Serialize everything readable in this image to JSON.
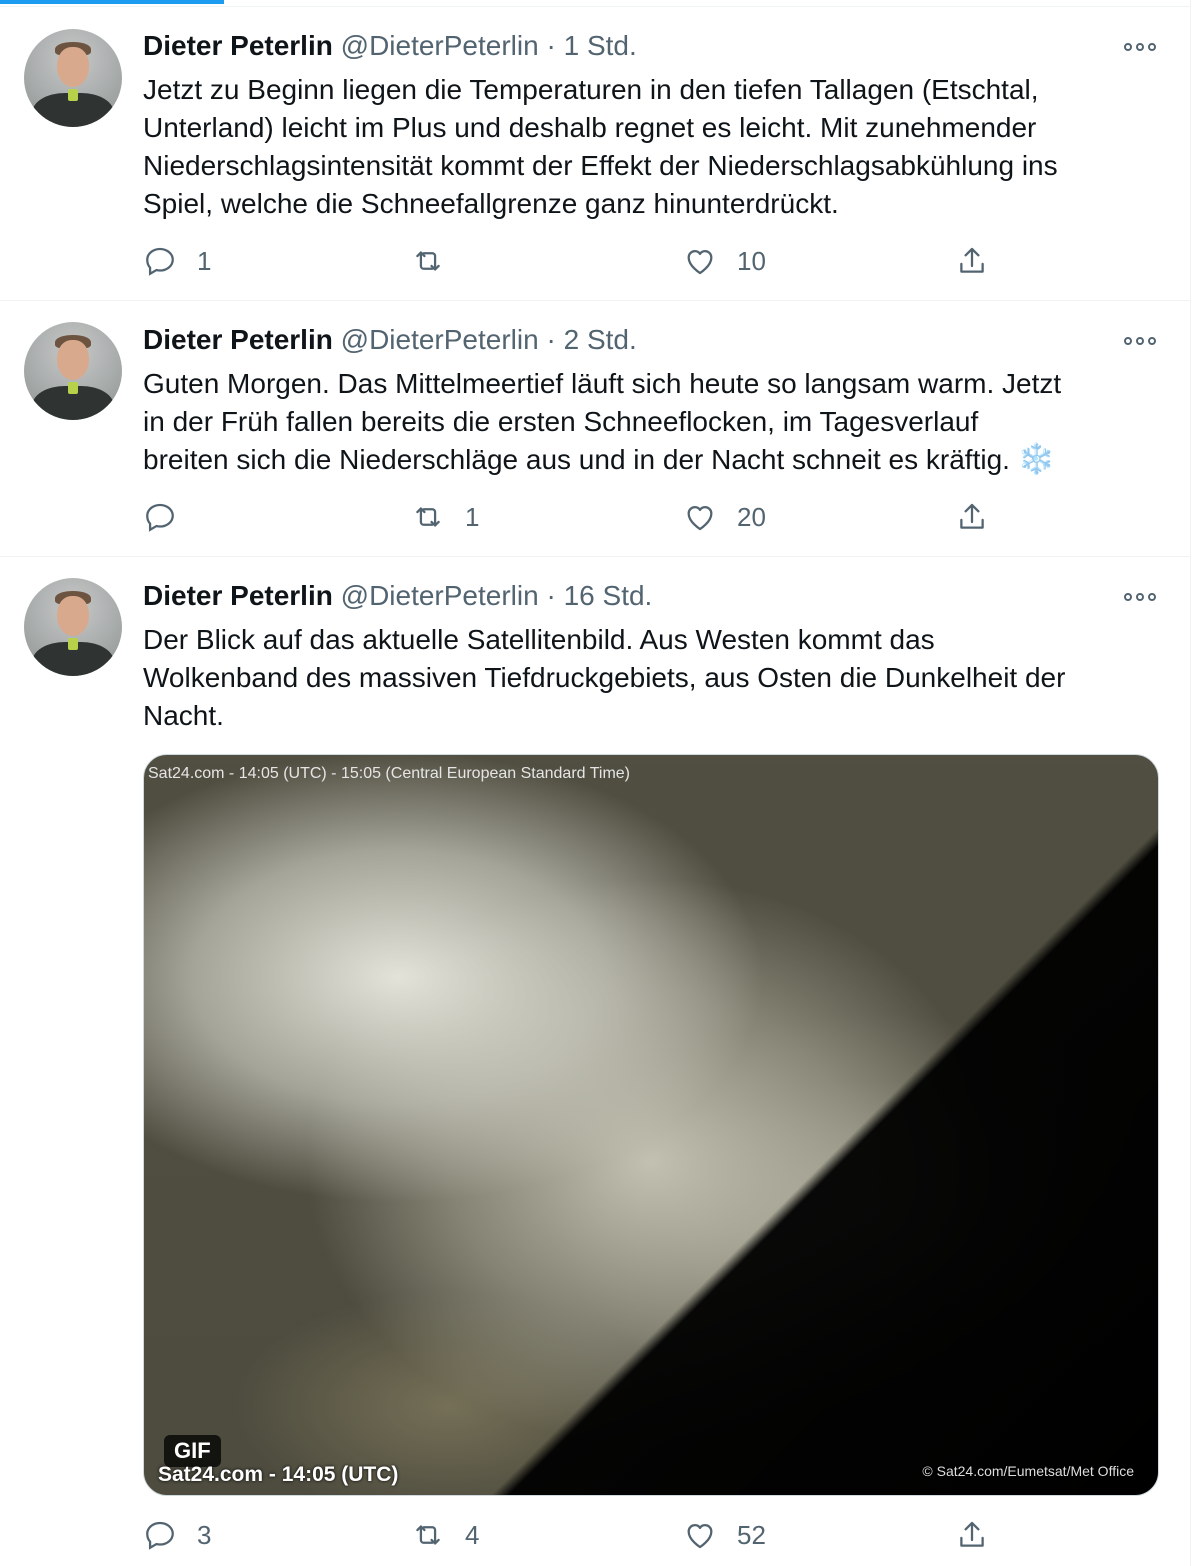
{
  "colors": {
    "accent": "#1d9bf0",
    "text": "#0f1419",
    "muted": "#536471",
    "divider": "#eff3f4"
  },
  "tweets": [
    {
      "author_name": "Dieter Peterlin",
      "handle": "@DieterPeterlin",
      "separator": "·",
      "time": "1 Std.",
      "lines": [
        "Jetzt zu Beginn liegen die Temperaturen in den tiefen Tallagen (Etschtal,",
        "Unterland) leicht im Plus und deshalb regnet es leicht. Mit zunehmender",
        "Niederschlagsintensität kommt der Effekt der Niederschlagsabkühlung ins",
        "Spiel, welche die Schneefallgrenze ganz hinunterdrückt."
      ],
      "replies": "1",
      "retweets": "",
      "likes": "10"
    },
    {
      "author_name": "Dieter Peterlin",
      "handle": "@DieterPeterlin",
      "separator": "·",
      "time": "2 Std.",
      "lines": [
        "Guten Morgen. Das Mittelmeertief läuft sich heute so langsam warm. Jetzt",
        "in der Früh fallen bereits die ersten Schneeflocken, im Tagesverlauf",
        "breiten sich die Niederschläge aus und in der Nacht schneit es kräftig."
      ],
      "emoji": "❄️",
      "replies": "",
      "retweets": "1",
      "likes": "20"
    },
    {
      "author_name": "Dieter Peterlin",
      "handle": "@DieterPeterlin",
      "separator": "·",
      "time": "16 Std.",
      "lines": [
        "Der Blick auf das aktuelle Satellitenbild. Aus Westen kommt das",
        "Wolkenband des massiven Tiefdruckgebiets, aus Osten die Dunkelheit der",
        "Nacht."
      ],
      "media": {
        "top_stamp": "Sat24.com - 14:05 (UTC) - 15:05 (Central European Standard Time)",
        "gif_badge": "GIF",
        "caption_left": "Sat24.com - 14:05 (UTC)",
        "caption_right": "© Sat24.com/Eumetsat/Met Office"
      },
      "replies": "3",
      "retweets": "4",
      "likes": "52"
    }
  ]
}
